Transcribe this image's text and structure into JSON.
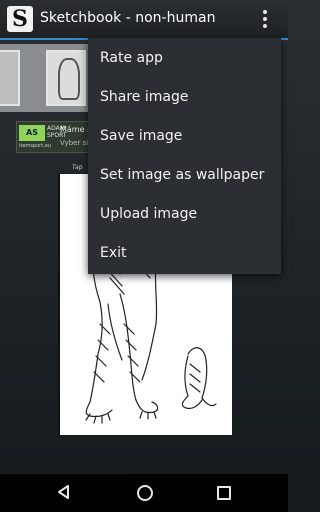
{
  "appbar": {
    "title": "Sketchbook - non-human",
    "icon_letter": "S",
    "accent_color": "#3b87c2"
  },
  "ad": {
    "logo": "AS",
    "brand_line1": "ADAM",
    "brand_line2": "SPORT",
    "site": "itemsport.eu",
    "text_line1": "Máme p",
    "text_line2": "Vyber si"
  },
  "tap_hint": "Tap",
  "menu": {
    "items": [
      {
        "label": "Rate app"
      },
      {
        "label": "Share image"
      },
      {
        "label": "Save image"
      },
      {
        "label": "Set image as wallpaper"
      },
      {
        "label": "Upload image"
      },
      {
        "label": "Exit"
      }
    ]
  },
  "navbar": {
    "back_icon": "back-icon",
    "home_icon": "home-icon",
    "recent_icon": "recent-apps-icon"
  }
}
